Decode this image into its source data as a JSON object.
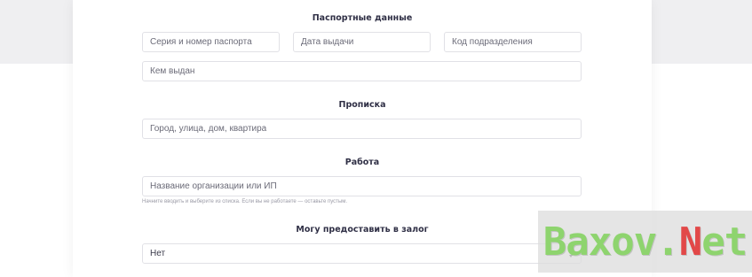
{
  "sections": {
    "passport": {
      "title": "Паспортные данные",
      "series_placeholder": "Серия и номер паспорта",
      "issue_date_placeholder": "Дата выдачи",
      "division_code_placeholder": "Код подразделения",
      "issued_by_placeholder": "Кем выдан"
    },
    "registration": {
      "title": "Прописка",
      "address_placeholder": "Город, улица, дом, квартира"
    },
    "work": {
      "title": "Работа",
      "organization_placeholder": "Название организации или ИП",
      "hint": "Начните вводить и выберите из списка. Если вы не работаете — оставьте пустым."
    },
    "collateral": {
      "title": "Могу предоставить в залог",
      "selected_value": "Нет"
    }
  },
  "watermark": {
    "text_main": "Baxov.",
    "text_accent": "N",
    "text_end": "et"
  }
}
